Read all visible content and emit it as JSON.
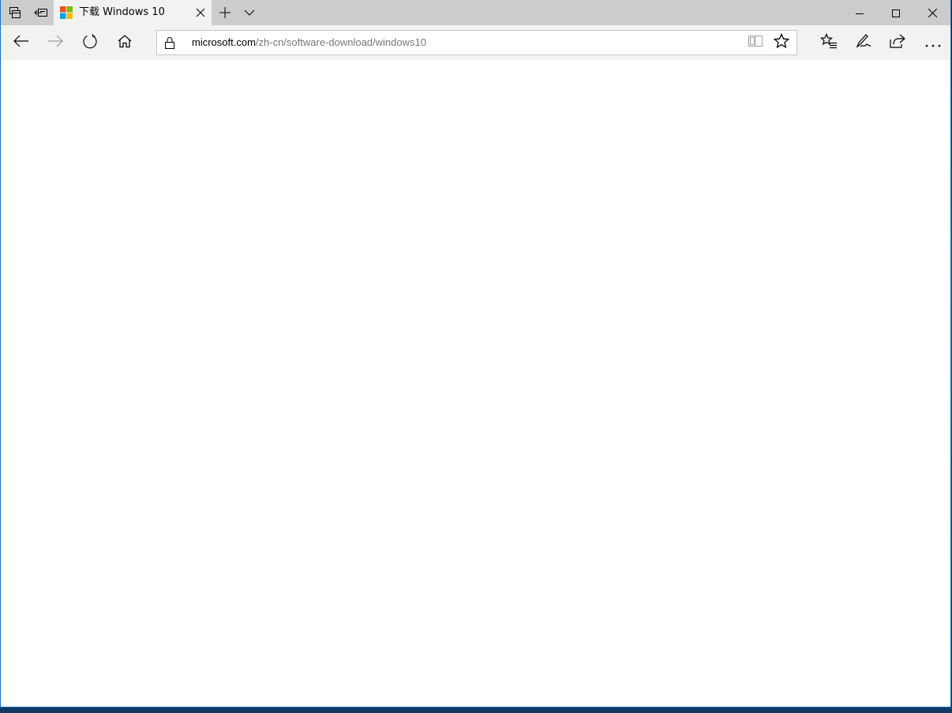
{
  "tab": {
    "title": "下载 Windows 10"
  },
  "address": {
    "host": "microsoft.com",
    "path": "/zh-cn/software-download/windows10"
  },
  "icons": {
    "tab_overview": "tab-overview-icon",
    "set_aside": "set-aside-tabs-icon",
    "favicon": "microsoft-logo-icon",
    "tab_close": "close-icon",
    "new_tab": "plus-icon",
    "tab_list": "chevron-down-icon",
    "minimize": "minimize-icon",
    "maximize": "maximize-icon",
    "close_window": "close-icon",
    "back": "arrow-left-icon",
    "forward": "arrow-right-icon",
    "refresh": "refresh-icon",
    "home": "home-icon",
    "lock": "lock-icon",
    "reading_view": "book-icon",
    "favorite": "star-icon",
    "favorites_hub": "favorites-list-icon",
    "web_note": "pen-icon",
    "share": "share-icon",
    "more": "more-icon"
  },
  "colors": {
    "titlebar": "#cccccc",
    "toolbar": "#f2f2f2",
    "window_border": "#1a6fc4",
    "url_path": "#767676"
  }
}
